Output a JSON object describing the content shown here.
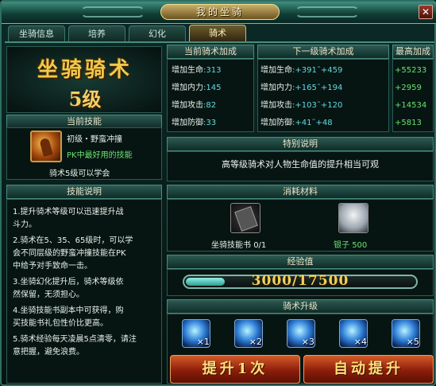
{
  "window": {
    "title": "我的坐骑",
    "close_label": "✕"
  },
  "tabs": [
    {
      "label": "坐骑信息",
      "active": false
    },
    {
      "label": "培养",
      "active": false
    },
    {
      "label": "幻化",
      "active": false
    },
    {
      "label": "骑术",
      "active": true
    }
  ],
  "header_panel": {
    "title": "坐骑骑术",
    "level": "5级"
  },
  "current_skill": {
    "header": "当前技能",
    "name": "初级・野蛮冲撞",
    "tagline": "PK中最好用的技能",
    "unlock": "骑术5级可以学会",
    "icon": "barbarian-charge-icon"
  },
  "skill_desc": {
    "header": "技能说明",
    "lines": [
      "1.提升骑术等级可以迅速提升战",
      "斗力。",
      "2.骑术在5、35、65级时，可以学",
      "会不同层级的野蛮冲撞技能在PK",
      "中给予对手致命一击。",
      "3.坐骑幻化提升后，骑术等级依",
      "然保留，无须担心。",
      "4.坐骑技能书副本中可获得，购",
      "买技能书礼包性价比更高。",
      "5.骑术经验每天凌晨5点清零，请注",
      "意把握，避免浪费。"
    ]
  },
  "bonus": {
    "current_header": "当前骑术加成",
    "next_header": "下一级骑术加成",
    "max_header": "最高加成",
    "rows": [
      {
        "label": "增加生命",
        "current": ":313",
        "next_label": "增加生命",
        "next": ":+391˜+459",
        "max": "+55233"
      },
      {
        "label": "增加内力",
        "current": ":145",
        "next_label": "增加内力",
        "next": ":+165˜+194",
        "max": "+2959"
      },
      {
        "label": "增加攻击",
        "current": ":82",
        "next_label": "增加攻击",
        "next": ":+103˜+120",
        "max": "+14534"
      },
      {
        "label": "增加防御",
        "current": ":33",
        "next_label": "增加防御",
        "next": ":+41˜+48",
        "max": "+5813"
      }
    ]
  },
  "special": {
    "header": "特别说明",
    "text": "高等级骑术对人物生命值的提升相当可观"
  },
  "materials": {
    "header": "消耗材料",
    "items": [
      {
        "name": "坐骑技能书",
        "count": "0/1",
        "icon": "skill-book-icon"
      },
      {
        "name": "银子",
        "count": "500",
        "icon": "silver-ingot-icon"
      }
    ]
  },
  "exp": {
    "header": "经验值",
    "current": 3000,
    "max": 17500,
    "text": "3000/17500",
    "fill_ratio": 0.171
  },
  "upgrade": {
    "header": "骑术升级",
    "orbs": [
      {
        "label": "×1",
        "icon": "blue-orb-icon"
      },
      {
        "label": "×2",
        "icon": "blue-orb-icon"
      },
      {
        "label": "×3",
        "icon": "blue-orb-icon"
      },
      {
        "label": "×4",
        "icon": "blue-orb-icon"
      },
      {
        "label": "×5",
        "icon": "blue-orb-icon"
      }
    ],
    "upgrade_once": "提升1次",
    "auto_upgrade": "自动提升"
  },
  "colors": {
    "accent_gold": "#f0c94c",
    "stat_cyan": "#64d9e0",
    "stat_green": "#69e36f",
    "button_red": "#8c1d0a"
  }
}
